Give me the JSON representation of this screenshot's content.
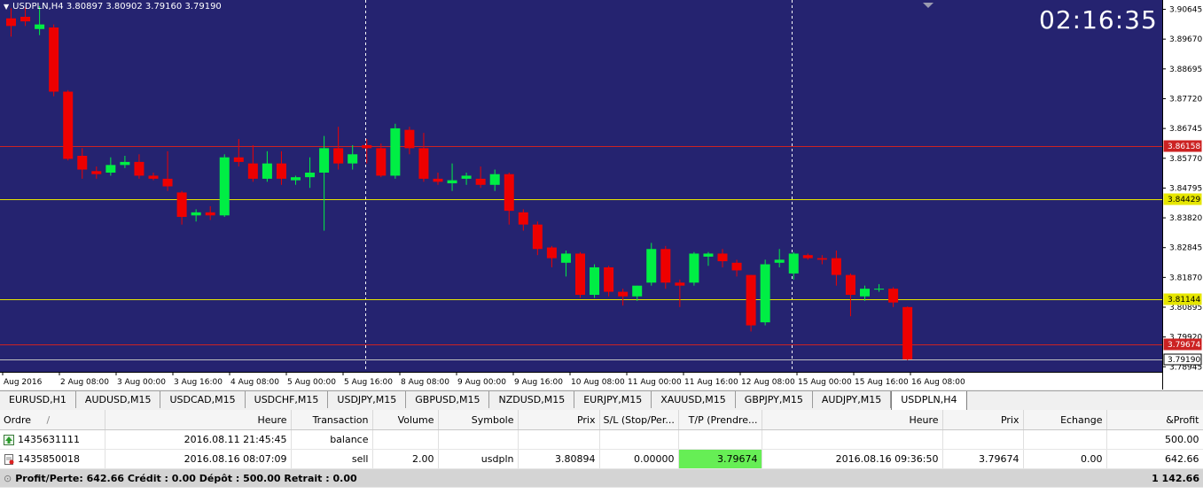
{
  "chart": {
    "symbol_header": "USDPLN,H4  3.80897 3.80902 3.79160 3.79190",
    "clock": "02:16:35",
    "colors": {
      "background": "#252370",
      "bull": "#00ee44",
      "bear": "#ee0000",
      "grid": "#ffffff"
    },
    "price_axis": {
      "min": 3.7878,
      "max": 3.9095
    },
    "price_labels": [
      "3.90645",
      "3.89670",
      "3.88695",
      "3.87720",
      "3.86745",
      "3.85770",
      "3.84795",
      "3.83820",
      "3.82845",
      "3.81870",
      "3.80895",
      "3.79920",
      "3.78945"
    ],
    "price_markers": [
      {
        "value": 3.86158,
        "label": "3.86158",
        "color": "#cc2222",
        "label_bg": "#cc2222",
        "label_fg": "#ffffff"
      },
      {
        "value": 3.84429,
        "label": "3.84429",
        "color": "#e6e600",
        "label_bg": "#e6e600",
        "label_fg": "#000000"
      },
      {
        "value": 3.81144,
        "label": "3.81144",
        "color": "#e6e600",
        "label_bg": "#e6e600",
        "label_fg": "#000000"
      },
      {
        "value": 3.79674,
        "label": "3.79674",
        "color": "#cc2222",
        "label_bg": "#cc2222",
        "label_fg": "#ffffff"
      },
      {
        "value": 3.7919,
        "label": "3.79190",
        "color": "#c0c0c0",
        "label_bg": "#ffffff",
        "label_fg": "#000000"
      }
    ],
    "time_labels": [
      "Aug 2016",
      "2 Aug 08:00",
      "3 Aug 00:00",
      "3 Aug 16:00",
      "4 Aug 08:00",
      "5 Aug 00:00",
      "5 Aug 16:00",
      "8 Aug 08:00",
      "9 Aug 00:00",
      "9 Aug 16:00",
      "10 Aug 08:00",
      "11 Aug 00:00",
      "11 Aug 16:00",
      "12 Aug 08:00",
      "15 Aug 00:00",
      "15 Aug 16:00",
      "16 Aug 08:00"
    ]
  },
  "chart_data": {
    "type": "candlestick",
    "candles": [
      {
        "o": 3.9035,
        "h": 3.9068,
        "l": 3.8975,
        "c": 3.901
      },
      {
        "o": 3.904,
        "h": 3.907,
        "l": 3.901,
        "c": 3.9025
      },
      {
        "o": 3.9,
        "h": 3.9075,
        "l": 3.898,
        "c": 3.9015
      },
      {
        "o": 3.9005,
        "h": 3.9015,
        "l": 3.878,
        "c": 3.8795
      },
      {
        "o": 3.8795,
        "h": 3.88,
        "l": 3.857,
        "c": 3.8575
      },
      {
        "o": 3.8585,
        "h": 3.861,
        "l": 3.851,
        "c": 3.854
      },
      {
        "o": 3.8535,
        "h": 3.855,
        "l": 3.851,
        "c": 3.8525
      },
      {
        "o": 3.853,
        "h": 3.858,
        "l": 3.852,
        "c": 3.8555
      },
      {
        "o": 3.8555,
        "h": 3.8585,
        "l": 3.8545,
        "c": 3.8565
      },
      {
        "o": 3.8565,
        "h": 3.859,
        "l": 3.851,
        "c": 3.852
      },
      {
        "o": 3.852,
        "h": 3.853,
        "l": 3.8505,
        "c": 3.851
      },
      {
        "o": 3.851,
        "h": 3.86,
        "l": 3.847,
        "c": 3.8485
      },
      {
        "o": 3.8465,
        "h": 3.847,
        "l": 3.836,
        "c": 3.8385
      },
      {
        "o": 3.839,
        "h": 3.841,
        "l": 3.837,
        "c": 3.84
      },
      {
        "o": 3.84,
        "h": 3.842,
        "l": 3.8375,
        "c": 3.839
      },
      {
        "o": 3.839,
        "h": 3.859,
        "l": 3.8385,
        "c": 3.858
      },
      {
        "o": 3.858,
        "h": 3.864,
        "l": 3.855,
        "c": 3.8565
      },
      {
        "o": 3.856,
        "h": 3.862,
        "l": 3.85,
        "c": 3.851
      },
      {
        "o": 3.851,
        "h": 3.86,
        "l": 3.85,
        "c": 3.856
      },
      {
        "o": 3.856,
        "h": 3.86,
        "l": 3.849,
        "c": 3.851
      },
      {
        "o": 3.8505,
        "h": 3.852,
        "l": 3.849,
        "c": 3.8515
      },
      {
        "o": 3.8515,
        "h": 3.858,
        "l": 3.848,
        "c": 3.853
      },
      {
        "o": 3.853,
        "h": 3.865,
        "l": 3.834,
        "c": 3.861
      },
      {
        "o": 3.861,
        "h": 3.868,
        "l": 3.854,
        "c": 3.856
      },
      {
        "o": 3.856,
        "h": 3.862,
        "l": 3.854,
        "c": 3.859
      },
      {
        "o": 3.862,
        "h": 3.864,
        "l": 3.856,
        "c": 3.861
      },
      {
        "o": 3.861,
        "h": 3.8625,
        "l": 3.8515,
        "c": 3.852
      },
      {
        "o": 3.852,
        "h": 3.869,
        "l": 3.851,
        "c": 3.8675
      },
      {
        "o": 3.867,
        "h": 3.868,
        "l": 3.859,
        "c": 3.861
      },
      {
        "o": 3.861,
        "h": 3.866,
        "l": 3.85,
        "c": 3.851
      },
      {
        "o": 3.851,
        "h": 3.853,
        "l": 3.849,
        "c": 3.85
      },
      {
        "o": 3.8495,
        "h": 3.856,
        "l": 3.847,
        "c": 3.8505
      },
      {
        "o": 3.851,
        "h": 3.853,
        "l": 3.849,
        "c": 3.852
      },
      {
        "o": 3.851,
        "h": 3.855,
        "l": 3.848,
        "c": 3.849
      },
      {
        "o": 3.849,
        "h": 3.854,
        "l": 3.847,
        "c": 3.8525
      },
      {
        "o": 3.8525,
        "h": 3.853,
        "l": 3.836,
        "c": 3.8405
      },
      {
        "o": 3.84,
        "h": 3.841,
        "l": 3.834,
        "c": 3.836
      },
      {
        "o": 3.836,
        "h": 3.837,
        "l": 3.826,
        "c": 3.828
      },
      {
        "o": 3.8285,
        "h": 3.829,
        "l": 3.822,
        "c": 3.825
      },
      {
        "o": 3.8235,
        "h": 3.8275,
        "l": 3.819,
        "c": 3.8265
      },
      {
        "o": 3.8265,
        "h": 3.827,
        "l": 3.812,
        "c": 3.813
      },
      {
        "o": 3.813,
        "h": 3.823,
        "l": 3.812,
        "c": 3.822
      },
      {
        "o": 3.822,
        "h": 3.8225,
        "l": 3.8125,
        "c": 3.814
      },
      {
        "o": 3.814,
        "h": 3.815,
        "l": 3.8095,
        "c": 3.8125
      },
      {
        "o": 3.8125,
        "h": 3.816,
        "l": 3.811,
        "c": 3.816
      },
      {
        "o": 3.817,
        "h": 3.83,
        "l": 3.816,
        "c": 3.828
      },
      {
        "o": 3.828,
        "h": 3.829,
        "l": 3.815,
        "c": 3.817
      },
      {
        "o": 3.817,
        "h": 3.818,
        "l": 3.809,
        "c": 3.816
      },
      {
        "o": 3.817,
        "h": 3.827,
        "l": 3.816,
        "c": 3.8265
      },
      {
        "o": 3.8255,
        "h": 3.827,
        "l": 3.8225,
        "c": 3.8265
      },
      {
        "o": 3.8265,
        "h": 3.828,
        "l": 3.822,
        "c": 3.824
      },
      {
        "o": 3.8235,
        "h": 3.8245,
        "l": 3.819,
        "c": 3.821
      },
      {
        "o": 3.8195,
        "h": 3.8195,
        "l": 3.801,
        "c": 3.803
      },
      {
        "o": 3.804,
        "h": 3.8245,
        "l": 3.803,
        "c": 3.823
      },
      {
        "o": 3.8235,
        "h": 3.828,
        "l": 3.822,
        "c": 3.8245
      },
      {
        "o": 3.82,
        "h": 3.827,
        "l": 3.818,
        "c": 3.8265
      },
      {
        "o": 3.826,
        "h": 3.8265,
        "l": 3.8245,
        "c": 3.825
      },
      {
        "o": 3.825,
        "h": 3.826,
        "l": 3.823,
        "c": 3.8245
      },
      {
        "o": 3.825,
        "h": 3.8275,
        "l": 3.816,
        "c": 3.8195
      },
      {
        "o": 3.8195,
        "h": 3.82,
        "l": 3.806,
        "c": 3.813
      },
      {
        "o": 3.8125,
        "h": 3.816,
        "l": 3.811,
        "c": 3.815
      },
      {
        "o": 3.815,
        "h": 3.8165,
        "l": 3.814,
        "c": 3.815
      },
      {
        "o": 3.815,
        "h": 3.8155,
        "l": 3.809,
        "c": 3.8105
      },
      {
        "o": 3.809,
        "h": 3.8092,
        "l": 3.7916,
        "c": 3.7919
      }
    ]
  },
  "tabs": [
    "EURUSD,H1",
    "AUDUSD,M15",
    "USDCAD,M15",
    "USDCHF,M15",
    "USDJPY,M15",
    "GBPUSD,M15",
    "NZDUSD,M15",
    "EURJPY,M15",
    "XAUUSD,M15",
    "GBPJPY,M15",
    "AUDJPY,M15",
    "USDPLN,H4"
  ],
  "terminal": {
    "columns": [
      "Ordre",
      "Heure",
      "Transaction",
      "Volume",
      "Symbole",
      "Prix",
      "S/L (Stop/Per...",
      "T/P (Prendre...",
      "Heure",
      "Prix",
      "Echange",
      "&Profit"
    ],
    "sort_indicator": "/",
    "rows": [
      {
        "order": "1435631111",
        "time": "2016.08.11 21:45:45",
        "type": "balance",
        "volume": "",
        "symbol": "",
        "price": "",
        "sl": "",
        "tp": "",
        "close_time": "",
        "close_price": "",
        "swap": "",
        "profit": "500.00"
      },
      {
        "order": "1435850018",
        "time": "2016.08.16 08:07:09",
        "type": "sell",
        "volume": "2.00",
        "symbol": "usdpln",
        "price": "3.80894",
        "sl": "0.00000",
        "tp": "3.79674",
        "close_time": "2016.08.16 09:36:50",
        "close_price": "3.79674",
        "swap": "0.00",
        "profit": "642.66"
      }
    ],
    "summary": "Profit/Perte: 642.66  Crédit : 0.00  Dépôt : 500.00  Retrait : 0.00",
    "summary_total": "1 142.66"
  }
}
